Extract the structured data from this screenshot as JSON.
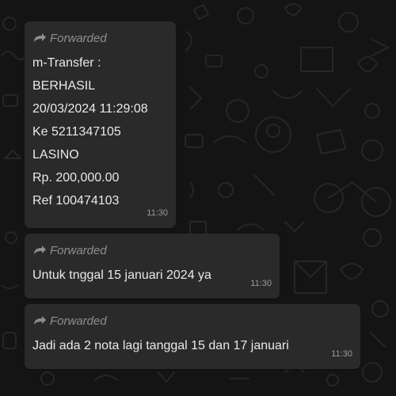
{
  "messages": [
    {
      "forwarded_label": "Forwarded",
      "lines": [
        "m-Transfer :",
        "BERHASIL",
        "20/03/2024 11:29:08",
        "Ke 5211347105",
        "LASINO",
        "Rp. 200,000.00",
        "Ref 100474103"
      ],
      "time": "11:30"
    },
    {
      "forwarded_label": "Forwarded",
      "lines": [
        "Untuk tnggal 15 januari 2024 ya"
      ],
      "time": "11:30"
    },
    {
      "forwarded_label": "Forwarded",
      "lines": [
        "Jadi ada 2 nota lagi tanggal 15 dan 17 januari"
      ],
      "time": "11:30"
    }
  ],
  "colors": {
    "background": "#141414",
    "bubble": "#2a2a2a",
    "text": "#e9e9e9",
    "meta": "#8e8e8e"
  },
  "icons": {
    "forwarded": "forward-arrow-icon"
  }
}
